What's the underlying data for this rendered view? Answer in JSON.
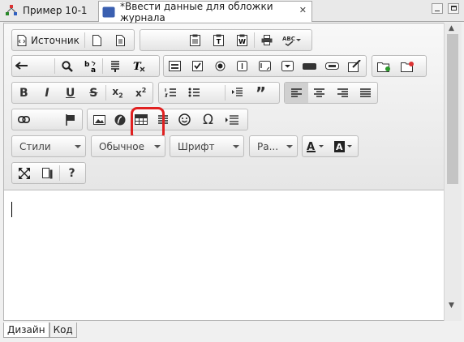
{
  "tabs": [
    {
      "label": "Пример 10-1",
      "icon": "workflow-icon"
    },
    {
      "label": "*Ввести данные для обложки журнала",
      "icon": "html-form-icon",
      "close": "✕"
    }
  ],
  "toolbar": {
    "source_label": "Источник",
    "styles_label": "Стили",
    "format_label": "Обычное",
    "font_label": "Шрифт",
    "size_label": "Ра...",
    "highlighted_button": "table-button"
  },
  "bottom_tabs": [
    "Дизайн",
    "Код"
  ],
  "colors": {
    "highlight": "#e02020",
    "selected": "#d0d0d0"
  }
}
